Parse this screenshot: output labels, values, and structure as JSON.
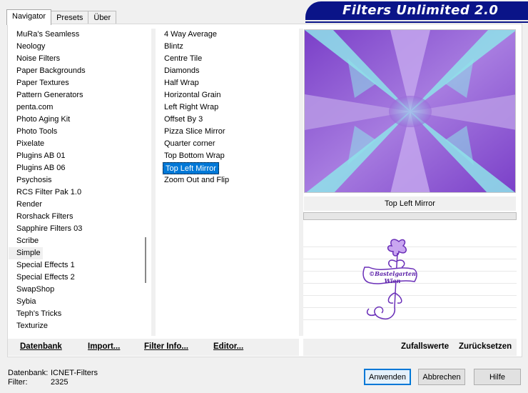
{
  "tabs": [
    {
      "label": "Navigator",
      "active": true
    },
    {
      "label": "Presets",
      "active": false
    },
    {
      "label": "Über",
      "active": false
    }
  ],
  "banner": {
    "title": "Filters Unlimited 2.0"
  },
  "categories": [
    "MuRa's Seamless",
    "Neology",
    "Noise Filters",
    "Paper Backgrounds",
    "Paper Textures",
    "Pattern Generators",
    "penta.com",
    "Photo Aging Kit",
    "Photo Tools",
    "Pixelate",
    "Plugins AB 01",
    "Plugins AB 06",
    "Psychosis",
    "RCS Filter Pak 1.0",
    "Render",
    "Rorshack Filters",
    "Sapphire Filters 03",
    "Scribe",
    "Simple",
    "Special Effects 1",
    "Special Effects 2",
    "SwapShop",
    "Sybia",
    "Teph's Tricks",
    "Texturize"
  ],
  "hovered_category": "Simple",
  "filters": [
    "4 Way Average",
    "Blintz",
    "Centre Tile",
    "Diamonds",
    "Half Wrap",
    "Horizontal Grain",
    "Left Right Wrap",
    "Offset By 3",
    "Pizza Slice Mirror",
    "Quarter corner",
    "Top Bottom Wrap",
    "Top Left Mirror",
    "Zoom Out and Flip"
  ],
  "selected_filter": "Top Left Mirror",
  "preview": {
    "filter_name": "Top Left Mirror",
    "progress": 0
  },
  "watermark": {
    "line1": "©Bastelgarten",
    "line2": "Wien"
  },
  "toolbar": {
    "datenbank": "Datenbank",
    "import": "Import...",
    "filter_info": "Filter Info...",
    "editor": "Editor...",
    "zufallswerte": "Zufallswerte",
    "zuruecksetzen": "Zurücksetzen"
  },
  "status": {
    "db_label": "Datenbank:",
    "db_value": "ICNET-Filters",
    "filter_label": "Filter:",
    "filter_value": "2325"
  },
  "buttons": {
    "apply": "Anwenden",
    "cancel": "Abbrechen",
    "help": "Hilfe"
  },
  "colors": {
    "accent": "#0078d7",
    "banner": "#0a1488",
    "preview_purple": "#8f5ad6",
    "preview_cyan": "#8fe3ea"
  }
}
